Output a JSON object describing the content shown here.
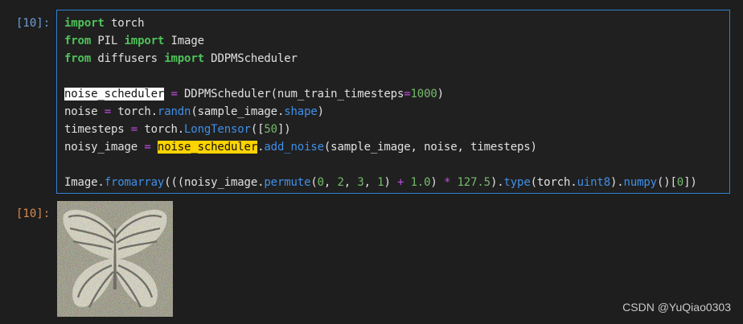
{
  "cell": {
    "in_prompt": "[10]:",
    "out_prompt": "[10]:",
    "lines": [
      [
        {
          "t": "import",
          "c": "kw"
        },
        {
          "t": " torch"
        }
      ],
      [
        {
          "t": "from",
          "c": "kw"
        },
        {
          "t": " PIL "
        },
        {
          "t": "import",
          "c": "kw"
        },
        {
          "t": " Image"
        }
      ],
      [
        {
          "t": "from",
          "c": "kw"
        },
        {
          "t": " diffusers "
        },
        {
          "t": "import",
          "c": "kw"
        },
        {
          "t": " DDPMScheduler"
        }
      ],
      [],
      [
        {
          "t": "noise_scheduler",
          "c": "hl-white"
        },
        {
          "t": " "
        },
        {
          "t": "=",
          "c": "op"
        },
        {
          "t": " DDPMScheduler(num_train_timesteps"
        },
        {
          "t": "=",
          "c": "op"
        },
        {
          "t": "1000",
          "c": "num"
        },
        {
          "t": ")"
        }
      ],
      [
        {
          "t": "noise "
        },
        {
          "t": "=",
          "c": "op"
        },
        {
          "t": " torch."
        },
        {
          "t": "randn",
          "c": "attr"
        },
        {
          "t": "(sample_image."
        },
        {
          "t": "shape",
          "c": "attr"
        },
        {
          "t": ")"
        }
      ],
      [
        {
          "t": "timesteps "
        },
        {
          "t": "=",
          "c": "op"
        },
        {
          "t": " torch."
        },
        {
          "t": "LongTensor",
          "c": "attr"
        },
        {
          "t": "(["
        },
        {
          "t": "50",
          "c": "num"
        },
        {
          "t": "])"
        }
      ],
      [
        {
          "t": "noisy_image "
        },
        {
          "t": "=",
          "c": "op"
        },
        {
          "t": " "
        },
        {
          "t": "noise_scheduler",
          "c": "hl-yellow"
        },
        {
          "t": "."
        },
        {
          "t": "add_noise",
          "c": "attr"
        },
        {
          "t": "(sample_image, noise, timesteps)"
        }
      ],
      [],
      [
        {
          "t": "Image."
        },
        {
          "t": "fromarray",
          "c": "attr"
        },
        {
          "t": "(((noisy_image."
        },
        {
          "t": "permute",
          "c": "attr"
        },
        {
          "t": "("
        },
        {
          "t": "0",
          "c": "num"
        },
        {
          "t": ", "
        },
        {
          "t": "2",
          "c": "num"
        },
        {
          "t": ", "
        },
        {
          "t": "3",
          "c": "num"
        },
        {
          "t": ", "
        },
        {
          "t": "1",
          "c": "num"
        },
        {
          "t": ") "
        },
        {
          "t": "+",
          "c": "op"
        },
        {
          "t": " "
        },
        {
          "t": "1.0",
          "c": "num"
        },
        {
          "t": ") "
        },
        {
          "t": "*",
          "c": "op"
        },
        {
          "t": " "
        },
        {
          "t": "127.5",
          "c": "num"
        },
        {
          "t": ")."
        },
        {
          "t": "type",
          "c": "attr"
        },
        {
          "t": "(torch."
        },
        {
          "t": "uint8",
          "c": "attr"
        },
        {
          "t": ")."
        },
        {
          "t": "numpy",
          "c": "attr"
        },
        {
          "t": "()["
        },
        {
          "t": "0",
          "c": "num"
        },
        {
          "t": "])"
        }
      ]
    ]
  },
  "output": {
    "image_icon": "noisy-butterfly-image"
  },
  "watermark": "CSDN @YuQiao0303",
  "colors": {
    "background": "#1e1e1e",
    "cell_border": "#2f80d0",
    "in_prompt": "#6f9fd8",
    "out_prompt": "#d7894f",
    "keyword": "#4fc25a",
    "operator": "#c04de0",
    "number": "#74bb6a",
    "attribute": "#3f8fe8",
    "highlight_selection": "#ffffff",
    "highlight_match": "#ffd400"
  }
}
